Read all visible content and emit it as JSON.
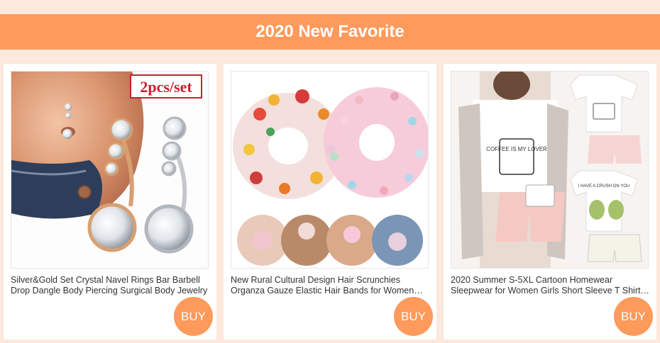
{
  "banner": {
    "title": "2020 New Favorite"
  },
  "products": [
    {
      "title": "Silver&Gold Set Crystal Navel Rings Bar Barbell Drop Dangle Body Piercing Surgical Body Jewelry",
      "badge": "2pcs/set",
      "buy_label": "BUY"
    },
    {
      "title": "New Rural Cultural Design Hair Scrunchies Organza Gauze Elastic Hair Bands for Women Girls",
      "buy_label": "BUY"
    },
    {
      "title": "2020 Summer S-5XL Cartoon Homewear Sleepwear for Women Girls Short Sleeve T Shirt Pajamas Set",
      "mug_text": "COFFEE IS MY LOVER",
      "tee_text": "I HAVE A CRUSH ON YOU",
      "buy_label": "BUY"
    }
  ],
  "colors": {
    "accent": "#fe9a5c",
    "background": "#fce8dc"
  }
}
